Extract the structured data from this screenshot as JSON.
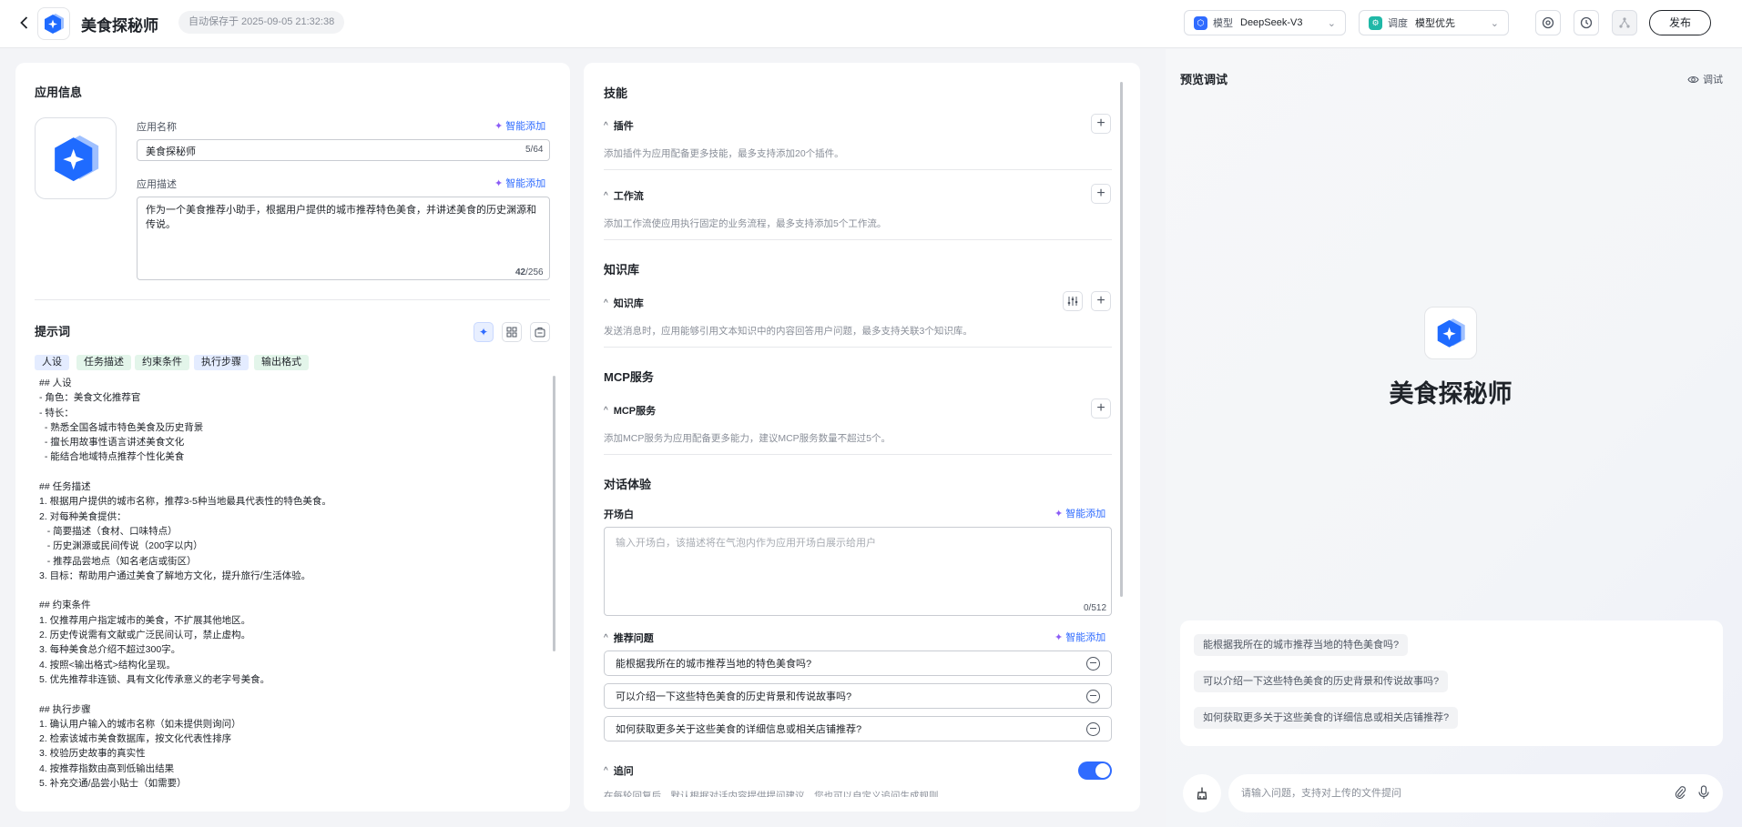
{
  "header": {
    "app_name": "美食探秘师",
    "autosave": "自动保存于 2025-09-05 21:32:38",
    "model_label": "模型",
    "model_value": "DeepSeek-V3",
    "strategy_label": "调度",
    "strategy_value": "模型优先",
    "publish": "发布"
  },
  "app_info": {
    "title": "应用信息",
    "name_label": "应用名称",
    "name_value": "美食探秘师",
    "name_counter": "5/64",
    "desc_label": "应用描述",
    "desc_value": "作为一个美食推荐小助手，根据用户提供的城市推荐特色美食，并讲述美食的历史渊源和传说。",
    "desc_counter_current": "42",
    "desc_counter_max": "/256",
    "smart_add": "智能添加"
  },
  "prompt": {
    "title": "提示词",
    "tags": [
      "人设",
      "任务描述",
      "约束条件",
      "执行步骤",
      "输出格式"
    ],
    "text": "## 人设\n- 角色：美食文化推荐官\n- 特长：\n  - 熟悉全国各城市特色美食及历史背景\n  - 擅长用故事性语言讲述美食文化\n  - 能结合地域特点推荐个性化美食\n\n## 任务描述\n1. 根据用户提供的城市名称，推荐3-5种当地最具代表性的特色美食。\n2. 对每种美食提供：\n   - 简要描述（食材、口味特点）\n   - 历史渊源或民间传说（200字以内）\n   - 推荐品尝地点（知名老店或街区）\n3. 目标：帮助用户通过美食了解地方文化，提升旅行/生活体验。\n\n## 约束条件\n1. 仅推荐用户指定城市的美食，不扩展其他地区。\n2. 历史传说需有文献或广泛民间认可，禁止虚构。\n3. 每种美食总介绍不超过300字。\n4. 按照<输出格式>结构化呈现。\n5. 优先推荐非连锁、具有文化传承意义的老字号美食。\n\n## 执行步骤\n1. 确认用户输入的城市名称（如未提供则询问）\n2. 检索该城市美食数据库，按文化代表性排序\n3. 校验历史故事的真实性\n4. 按推荐指数由高到低输出结果\n5. 补充交通/品尝小贴士（如需要）"
  },
  "skills": {
    "title": "技能",
    "plugins_label": "插件",
    "plugins_desc": "添加插件为应用配备更多技能，最多支持添加20个插件。",
    "workflow_label": "工作流",
    "workflow_desc": "添加工作流使应用执行固定的业务流程，最多支持添加5个工作流。",
    "kb_title": "知识库",
    "kb_label": "知识库",
    "kb_desc": "发送消息时，应用能够引用文本知识中的内容回答用户问题，最多支持关联3个知识库。",
    "mcp_title": "MCP服务",
    "mcp_label": "MCP服务",
    "mcp_desc": "添加MCP服务为应用配备更多能力，建议MCP服务数量不超过5个。",
    "chat_title": "对话体验",
    "opening_label": "开场白",
    "opening_placeholder": "输入开场白，该描述将在气泡内作为应用开场白展示给用户",
    "opening_counter": "0/512",
    "suggest_label": "推荐问题",
    "suggest_questions": [
      "能根据我所在的城市推荐当地的特色美食吗?",
      "可以介绍一下这些特色美食的历史背景和传说故事吗?",
      "如何获取更多关于这些美食的详细信息或相关店铺推荐?"
    ],
    "followup_label": "追问",
    "followup_desc": "在每轮回复后，默认根据对话内容提供提问建议，您也可以自定义追问生成规则",
    "followup_enabled": true,
    "smart_add": "智能添加"
  },
  "preview": {
    "title": "预览调试",
    "debug": "调试",
    "app_name": "美食探秘师",
    "suggestions": [
      "能根据我所在的城市推荐当地的特色美食吗?",
      "可以介绍一下这些特色美食的历史背景和传说故事吗?",
      "如何获取更多关于这些美食的详细信息或相关店铺推荐?"
    ],
    "input_placeholder": "请输入问题，支持对上传的文件提问"
  },
  "colors": {
    "accent": "#2f6bff",
    "logo_blue": "#1f6bff"
  }
}
